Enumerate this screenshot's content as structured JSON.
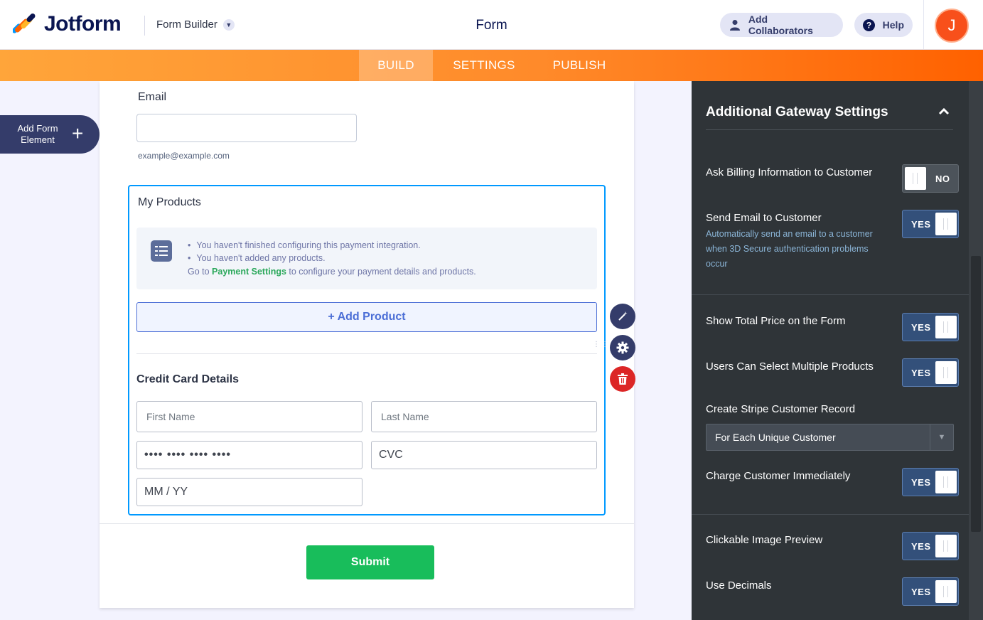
{
  "header": {
    "logo_text": "Jotform",
    "builder_dropdown": "Form Builder",
    "form_title": "Form",
    "add_collaborators": "Add Collaborators",
    "help": "Help",
    "avatar_initial": "J"
  },
  "nav": {
    "tabs": [
      {
        "label": "BUILD",
        "active": true
      },
      {
        "label": "SETTINGS",
        "active": false
      },
      {
        "label": "PUBLISH",
        "active": false
      }
    ]
  },
  "sidebar": {
    "add_form_element": "Add Form Element"
  },
  "form": {
    "email": {
      "label": "Email",
      "value": "",
      "hint": "example@example.com"
    },
    "products": {
      "title": "My Products",
      "notice": [
        "You haven't finished configuring this payment integration.",
        "You haven't added any products."
      ],
      "goto_prefix": "Go to ",
      "goto_link": "Payment Settings",
      "goto_suffix": " to configure your payment details and products.",
      "add_product": "+ Add Product"
    },
    "credit_card": {
      "title": "Credit Card Details",
      "first_name_placeholder": "First Name",
      "last_name_placeholder": "Last Name",
      "card_number_placeholder": "•••• •••• •••• ••••",
      "cvc_placeholder": "CVC",
      "expiry_placeholder": "MM / YY"
    },
    "submit": "Submit"
  },
  "panel": {
    "title": "Additional Gateway Settings",
    "options": [
      {
        "label": "Ask Billing Information to Customer",
        "state": "NO"
      },
      {
        "label": "Send Email to Customer",
        "description": "Automatically send an email to a customer when 3D Secure authentication problems occur",
        "state": "YES"
      },
      {
        "label": "Show Total Price on the Form",
        "state": "YES"
      },
      {
        "label": "Users Can Select Multiple Products",
        "state": "YES"
      },
      {
        "label": "Create Stripe Customer Record",
        "select_value": "For Each Unique Customer"
      },
      {
        "label": "Charge Customer Immediately",
        "state": "YES"
      },
      {
        "label": "Clickable Image Preview",
        "state": "YES"
      },
      {
        "label": "Use Decimals",
        "state": "YES"
      }
    ]
  },
  "colors": {
    "accent_orange": "#ff6100",
    "primary_navy": "#0a1551",
    "submit_green": "#18bd5b",
    "delete_red": "#dc2626",
    "selected_border": "#0099ff"
  }
}
